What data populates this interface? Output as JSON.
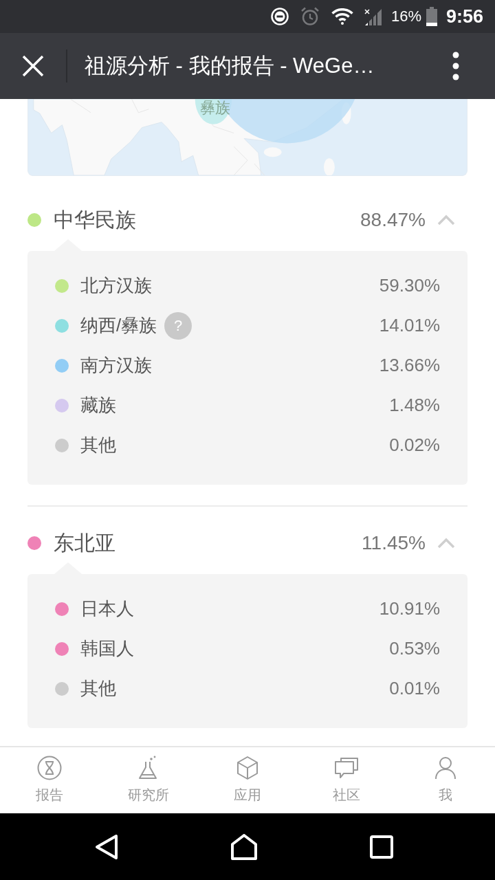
{
  "status_bar": {
    "battery": "16%",
    "time": "9:56"
  },
  "header": {
    "title": "祖源分析 - 我的报告 - WeGe…"
  },
  "map": {
    "labels": [
      {
        "text": "彝族"
      }
    ]
  },
  "groups": [
    {
      "name": "中华民族",
      "percent": "88.47%",
      "color": "#bde786",
      "expanded": true,
      "items": [
        {
          "name": "北方汉族",
          "percent": "59.30%",
          "color": "#c2e88b"
        },
        {
          "name": "纳西/彝族",
          "percent": "14.01%",
          "color": "#8edfe1",
          "hint": "?"
        },
        {
          "name": "南方汉族",
          "percent": "13.66%",
          "color": "#92cdf5"
        },
        {
          "name": "藏族",
          "percent": "1.48%",
          "color": "#d5c9ef"
        },
        {
          "name": "其他",
          "percent": "0.02%",
          "color": "#cccccc"
        }
      ]
    },
    {
      "name": "东北亚",
      "percent": "11.45%",
      "color": "#ef82b6",
      "expanded": true,
      "items": [
        {
          "name": "日本人",
          "percent": "10.91%",
          "color": "#ef82b6"
        },
        {
          "name": "韩国人",
          "percent": "0.53%",
          "color": "#ef82b6"
        },
        {
          "name": "其他",
          "percent": "0.01%",
          "color": "#cccccc"
        }
      ]
    }
  ],
  "tab_bar": [
    {
      "label": "报告",
      "selected": false
    },
    {
      "label": "研究所",
      "selected": false
    },
    {
      "label": "应用",
      "selected": false
    },
    {
      "label": "社区",
      "selected": false
    },
    {
      "label": "我",
      "selected": false
    }
  ]
}
